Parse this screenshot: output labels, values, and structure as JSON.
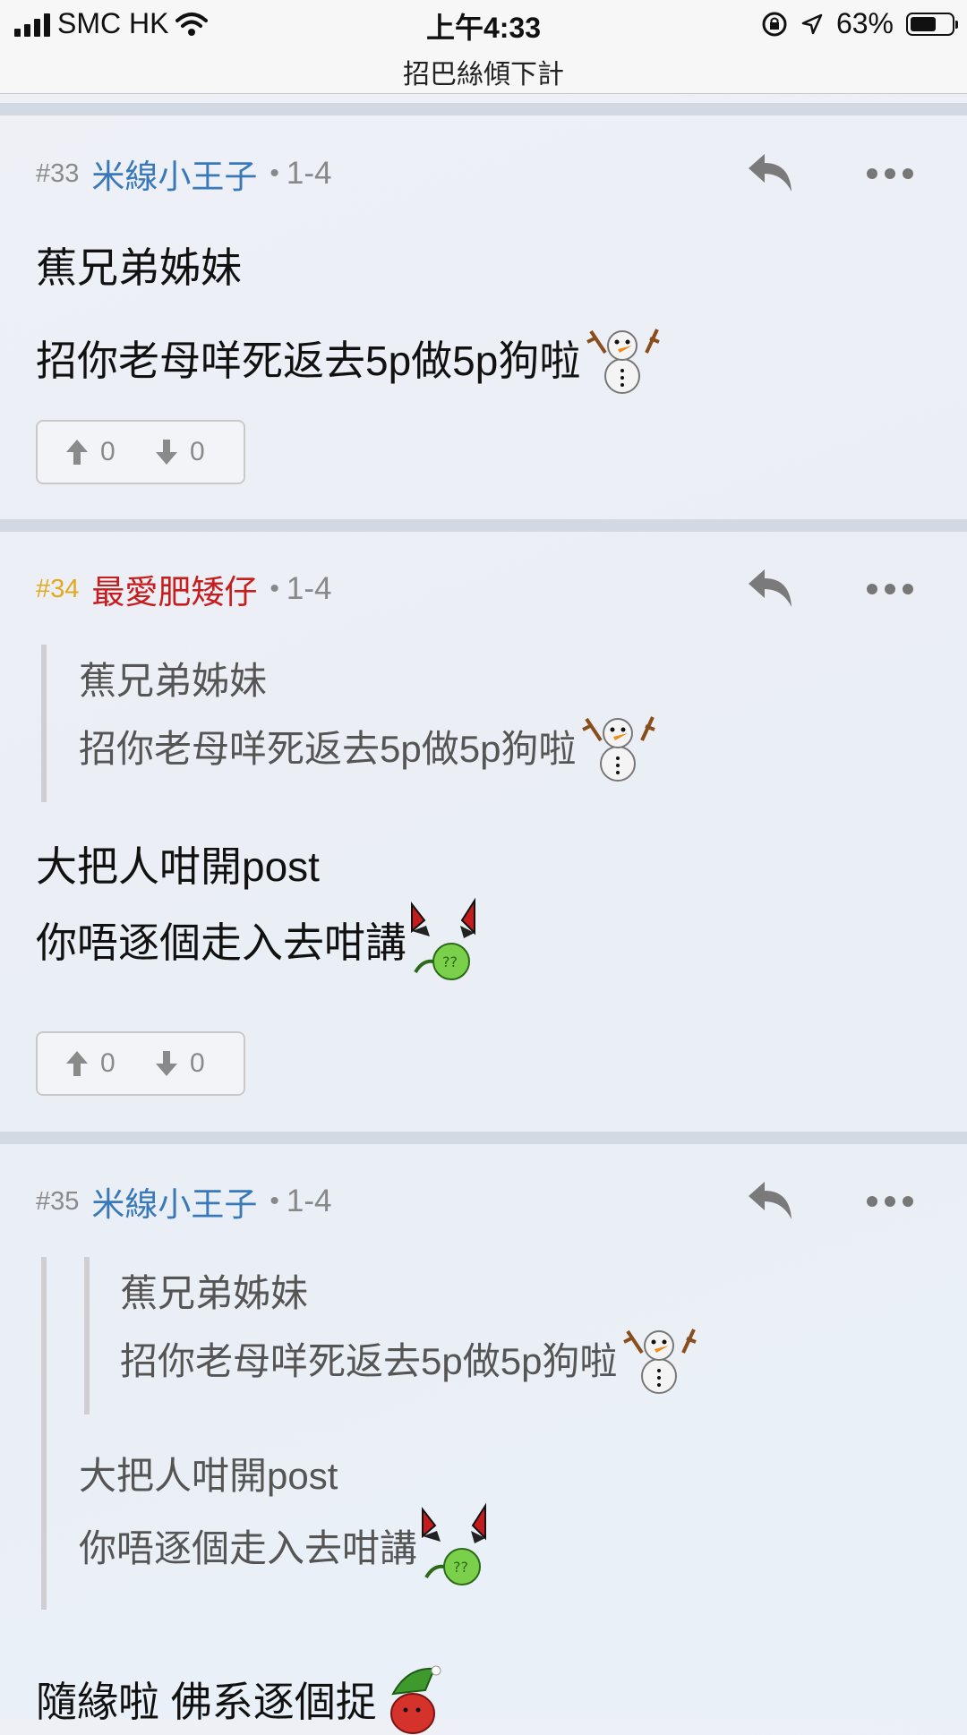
{
  "status_bar": {
    "carrier": "SMC HK",
    "time": "上午4:33",
    "battery_percent_label": "63%",
    "battery_level": 0.63
  },
  "thread": {
    "title": "招巴絲傾下計"
  },
  "posts": [
    {
      "number": "#33",
      "author": "米線小王子",
      "date": "1-4",
      "lines": [
        "蕉兄弟姊妹",
        "招你老母咩死返去5p做5p狗啦"
      ],
      "upvotes": "0",
      "downvotes": "0"
    },
    {
      "number": "#34",
      "author": "最愛肥矮仔",
      "date": "1-4",
      "quote": [
        "蕉兄弟姊妹",
        "招你老母咩死返去5p做5p狗啦"
      ],
      "lines": [
        "大把人咁開post",
        "你唔逐個走入去咁講"
      ],
      "upvotes": "0",
      "downvotes": "0"
    },
    {
      "number": "#35",
      "author": "米線小王子",
      "date": "1-4",
      "quote_nested": [
        "蕉兄弟姊妹",
        "招你老母咩死返去5p做5p狗啦"
      ],
      "quote": [
        "大把人咁開post",
        "你唔逐個走入去咁講"
      ],
      "lines": [
        "隨緣啦 佛系逐個捉"
      ]
    }
  ],
  "colors": {
    "author_blue": "#3a79b9",
    "author_red": "#c81d1d",
    "number_gold": "#e3a91c"
  },
  "icons": [
    "signal-icon",
    "wifi-icon",
    "orientation-lock-icon",
    "location-icon",
    "battery-icon",
    "reply-icon",
    "more-icon",
    "upvote-icon",
    "downvote-icon",
    "snowman-emote-icon",
    "santa-hat-emote-icon",
    "strawberry-emote-icon"
  ]
}
